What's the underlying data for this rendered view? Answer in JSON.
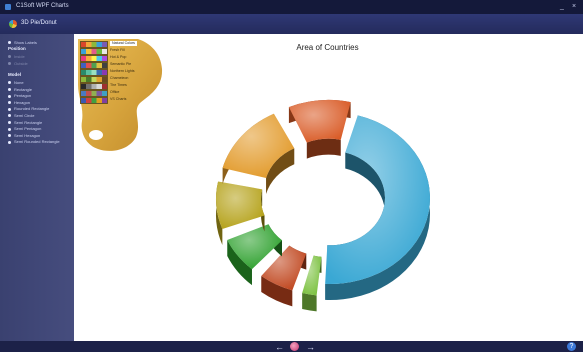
{
  "window": {
    "title": "C1Soft WPF Charts",
    "minimize": "_",
    "close": "×"
  },
  "ribbon": {
    "title": "3D Pie/Donut"
  },
  "sidebar": {
    "show_labels": "Show Labels",
    "position_heading": "Position",
    "positions": [
      "Inside",
      "Outside"
    ],
    "model_heading": "Model",
    "models": [
      "None",
      "Rectangle",
      "Pentagon",
      "Hexagon",
      "Rounded Rectangle",
      "Semi Circle",
      "Semi Rectangle",
      "Semi Pentagon",
      "Semi Hexagon",
      "Semi Rounded Rectangle"
    ]
  },
  "palettes": [
    {
      "label": "Natural Colors",
      "colors": [
        "#d9462b",
        "#f2a53a",
        "#8cb93a",
        "#3aa0d8",
        "#7a5bb5"
      ]
    },
    {
      "label": "Fresh Fill",
      "colors": [
        "#3aa0d8",
        "#f2c23a",
        "#e25b8a",
        "#6bb83a",
        "#e6e6e6"
      ]
    },
    {
      "label": "Hot & Pop",
      "colors": [
        "#e93a7d",
        "#f8ab3c",
        "#fff44a",
        "#4bc8e8",
        "#a84be0"
      ]
    },
    {
      "label": "Semantic Pie",
      "colors": [
        "#4060c0",
        "#e05050",
        "#50a050",
        "#e0c040",
        "#404040"
      ]
    },
    {
      "label": "Northern Lights",
      "colors": [
        "#2a8a6a",
        "#5ac0a0",
        "#9ae0c0",
        "#3a6ab0",
        "#8a3ab0"
      ]
    },
    {
      "label": "Chameleon",
      "colors": [
        "#8fb83a",
        "#4a7a2a",
        "#c0d860",
        "#e0a030",
        "#6a4a20"
      ]
    },
    {
      "label": "The Times",
      "colors": [
        "#2a2a2a",
        "#707070",
        "#b0b0b0",
        "#d8d8d8",
        "#a03030"
      ]
    },
    {
      "label": "Office",
      "colors": [
        "#4a7ac0",
        "#c05050",
        "#90b050",
        "#7a5aa0",
        "#40a0c0"
      ]
    },
    {
      "label": "VS Charts",
      "colors": [
        "#3a5ab0",
        "#d04040",
        "#40a040",
        "#e0a020",
        "#8040a0"
      ]
    }
  ],
  "selected_palette": "Natural Colors",
  "chart_data": {
    "type": "pie",
    "title": "Area of Countries",
    "variant": "3D donut",
    "categories": [
      "",
      "",
      "",
      "",
      "",
      "",
      ""
    ],
    "values": [
      0.43,
      0.03,
      0.06,
      0.07,
      0.09,
      0.13,
      0.1
    ],
    "colors": [
      "#3aa8d4",
      "#7dc242",
      "#c0461e",
      "#2ca02c",
      "#b5a21a",
      "#e29a2a",
      "#d95a25"
    ],
    "legend": "none"
  },
  "footer": {
    "prev": "←",
    "next": "→",
    "help": "?"
  }
}
